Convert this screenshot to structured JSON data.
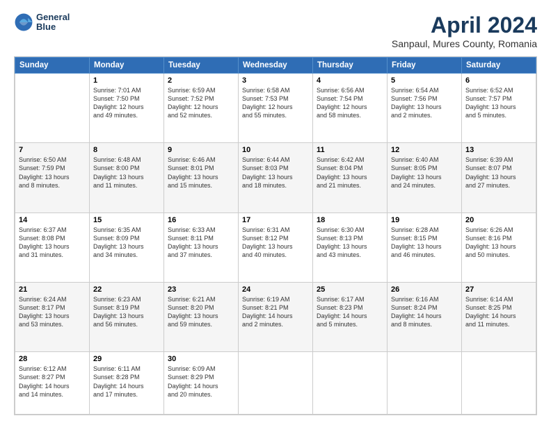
{
  "header": {
    "logo_line1": "General",
    "logo_line2": "Blue",
    "title": "April 2024",
    "subtitle": "Sanpaul, Mures County, Romania"
  },
  "weekdays": [
    "Sunday",
    "Monday",
    "Tuesday",
    "Wednesday",
    "Thursday",
    "Friday",
    "Saturday"
  ],
  "weeks": [
    [
      {
        "day": "",
        "info": ""
      },
      {
        "day": "1",
        "info": "Sunrise: 7:01 AM\nSunset: 7:50 PM\nDaylight: 12 hours\nand 49 minutes."
      },
      {
        "day": "2",
        "info": "Sunrise: 6:59 AM\nSunset: 7:52 PM\nDaylight: 12 hours\nand 52 minutes."
      },
      {
        "day": "3",
        "info": "Sunrise: 6:58 AM\nSunset: 7:53 PM\nDaylight: 12 hours\nand 55 minutes."
      },
      {
        "day": "4",
        "info": "Sunrise: 6:56 AM\nSunset: 7:54 PM\nDaylight: 12 hours\nand 58 minutes."
      },
      {
        "day": "5",
        "info": "Sunrise: 6:54 AM\nSunset: 7:56 PM\nDaylight: 13 hours\nand 2 minutes."
      },
      {
        "day": "6",
        "info": "Sunrise: 6:52 AM\nSunset: 7:57 PM\nDaylight: 13 hours\nand 5 minutes."
      }
    ],
    [
      {
        "day": "7",
        "info": "Sunrise: 6:50 AM\nSunset: 7:59 PM\nDaylight: 13 hours\nand 8 minutes."
      },
      {
        "day": "8",
        "info": "Sunrise: 6:48 AM\nSunset: 8:00 PM\nDaylight: 13 hours\nand 11 minutes."
      },
      {
        "day": "9",
        "info": "Sunrise: 6:46 AM\nSunset: 8:01 PM\nDaylight: 13 hours\nand 15 minutes."
      },
      {
        "day": "10",
        "info": "Sunrise: 6:44 AM\nSunset: 8:03 PM\nDaylight: 13 hours\nand 18 minutes."
      },
      {
        "day": "11",
        "info": "Sunrise: 6:42 AM\nSunset: 8:04 PM\nDaylight: 13 hours\nand 21 minutes."
      },
      {
        "day": "12",
        "info": "Sunrise: 6:40 AM\nSunset: 8:05 PM\nDaylight: 13 hours\nand 24 minutes."
      },
      {
        "day": "13",
        "info": "Sunrise: 6:39 AM\nSunset: 8:07 PM\nDaylight: 13 hours\nand 27 minutes."
      }
    ],
    [
      {
        "day": "14",
        "info": "Sunrise: 6:37 AM\nSunset: 8:08 PM\nDaylight: 13 hours\nand 31 minutes."
      },
      {
        "day": "15",
        "info": "Sunrise: 6:35 AM\nSunset: 8:09 PM\nDaylight: 13 hours\nand 34 minutes."
      },
      {
        "day": "16",
        "info": "Sunrise: 6:33 AM\nSunset: 8:11 PM\nDaylight: 13 hours\nand 37 minutes."
      },
      {
        "day": "17",
        "info": "Sunrise: 6:31 AM\nSunset: 8:12 PM\nDaylight: 13 hours\nand 40 minutes."
      },
      {
        "day": "18",
        "info": "Sunrise: 6:30 AM\nSunset: 8:13 PM\nDaylight: 13 hours\nand 43 minutes."
      },
      {
        "day": "19",
        "info": "Sunrise: 6:28 AM\nSunset: 8:15 PM\nDaylight: 13 hours\nand 46 minutes."
      },
      {
        "day": "20",
        "info": "Sunrise: 6:26 AM\nSunset: 8:16 PM\nDaylight: 13 hours\nand 50 minutes."
      }
    ],
    [
      {
        "day": "21",
        "info": "Sunrise: 6:24 AM\nSunset: 8:17 PM\nDaylight: 13 hours\nand 53 minutes."
      },
      {
        "day": "22",
        "info": "Sunrise: 6:23 AM\nSunset: 8:19 PM\nDaylight: 13 hours\nand 56 minutes."
      },
      {
        "day": "23",
        "info": "Sunrise: 6:21 AM\nSunset: 8:20 PM\nDaylight: 13 hours\nand 59 minutes."
      },
      {
        "day": "24",
        "info": "Sunrise: 6:19 AM\nSunset: 8:21 PM\nDaylight: 14 hours\nand 2 minutes."
      },
      {
        "day": "25",
        "info": "Sunrise: 6:17 AM\nSunset: 8:23 PM\nDaylight: 14 hours\nand 5 minutes."
      },
      {
        "day": "26",
        "info": "Sunrise: 6:16 AM\nSunset: 8:24 PM\nDaylight: 14 hours\nand 8 minutes."
      },
      {
        "day": "27",
        "info": "Sunrise: 6:14 AM\nSunset: 8:25 PM\nDaylight: 14 hours\nand 11 minutes."
      }
    ],
    [
      {
        "day": "28",
        "info": "Sunrise: 6:12 AM\nSunset: 8:27 PM\nDaylight: 14 hours\nand 14 minutes."
      },
      {
        "day": "29",
        "info": "Sunrise: 6:11 AM\nSunset: 8:28 PM\nDaylight: 14 hours\nand 17 minutes."
      },
      {
        "day": "30",
        "info": "Sunrise: 6:09 AM\nSunset: 8:29 PM\nDaylight: 14 hours\nand 20 minutes."
      },
      {
        "day": "",
        "info": ""
      },
      {
        "day": "",
        "info": ""
      },
      {
        "day": "",
        "info": ""
      },
      {
        "day": "",
        "info": ""
      }
    ]
  ],
  "row_shading": [
    "white",
    "shade",
    "white",
    "shade",
    "white"
  ]
}
